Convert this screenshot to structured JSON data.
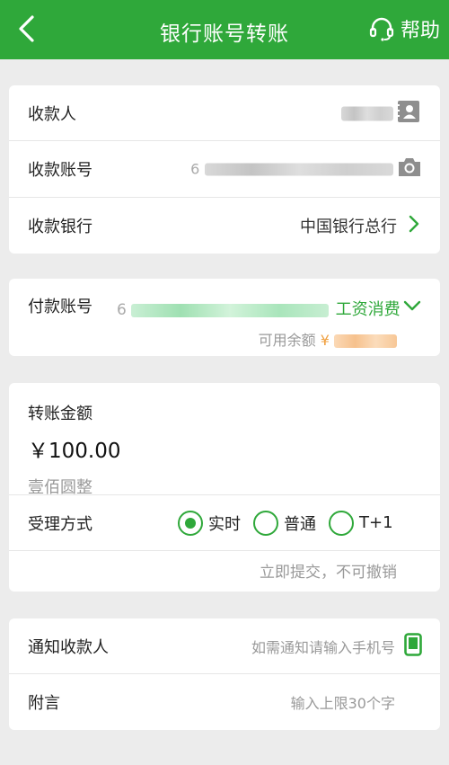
{
  "header": {
    "title": "银行账号转账",
    "help_label": "帮助"
  },
  "payee_card": {
    "payee_label": "收款人",
    "account_label": "收款账号",
    "account_prefix": "6",
    "bank_label": "收款银行",
    "bank_value": "中国银行总行"
  },
  "payer_card": {
    "account_label": "付款账号",
    "account_prefix": "6",
    "account_type": "工资消费",
    "balance_label": "可用余额",
    "currency_symbol": "¥"
  },
  "amount_card": {
    "amount_label": "转账金额",
    "amount_value": "￥100.00",
    "amount_chinese": "壹佰圆整",
    "mode_label": "受理方式",
    "modes": [
      {
        "label": "实时",
        "checked": true
      },
      {
        "label": "普通",
        "checked": false
      },
      {
        "label": "T+1",
        "checked": false
      }
    ],
    "mode_note": "立即提交，不可撤销"
  },
  "notify_card": {
    "notify_label": "通知收款人",
    "notify_placeholder": "如需通知请输入手机号",
    "remark_label": "附言",
    "remark_placeholder": "输入上限30个字"
  },
  "colors": {
    "brand_green": "#2fa83a",
    "background": "#ececec"
  },
  "icons": [
    "back-arrow-icon",
    "headset-icon",
    "contact-book-icon",
    "camera-icon",
    "chevron-right-icon",
    "chevron-down-icon",
    "mobile-phone-icon"
  ]
}
